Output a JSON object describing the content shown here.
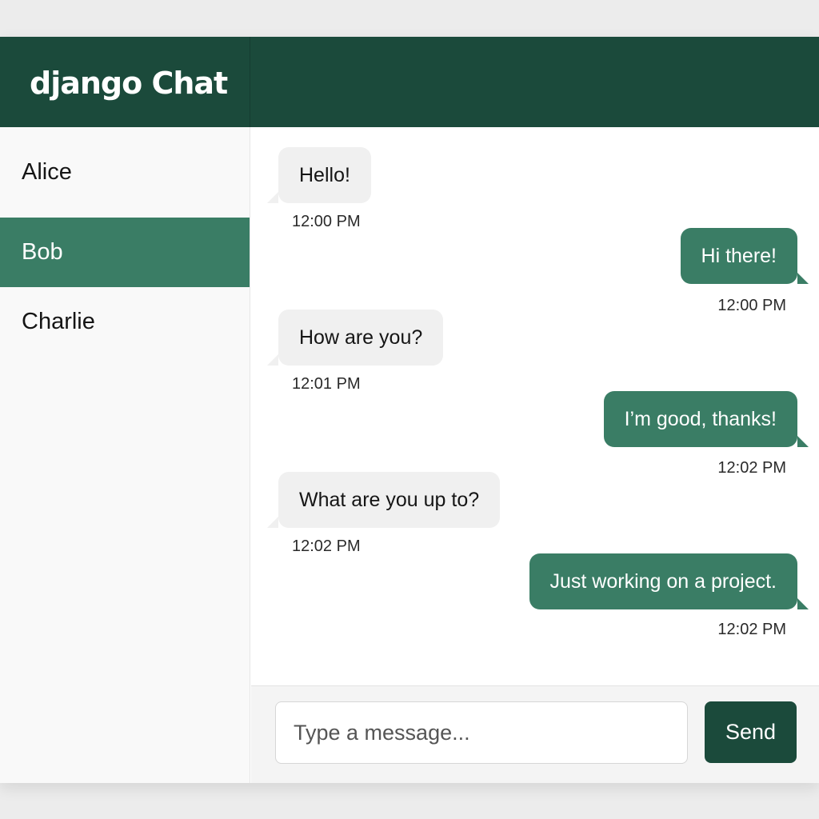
{
  "app": {
    "brand": "django Chat"
  },
  "sidebar": {
    "contacts": [
      {
        "name": "Alice"
      },
      {
        "name": "Bob",
        "active": true
      },
      {
        "name": "Charlie"
      }
    ]
  },
  "chat": {
    "messages": [
      {
        "direction": "incoming",
        "text": "Hello!",
        "time": "12:00 PM"
      },
      {
        "direction": "outgoing",
        "text": "Hi there!",
        "time": "12:00 PM"
      },
      {
        "direction": "incoming",
        "text": "How are you?",
        "time": "12:01 PM"
      },
      {
        "direction": "outgoing",
        "text": "I’m good, thanks!",
        "time": "12:02 PM"
      },
      {
        "direction": "incoming",
        "text": "What are you up to?",
        "time": "12:02 PM"
      },
      {
        "direction": "outgoing",
        "text": "Just working on a project.",
        "time": "12:02 PM"
      }
    ]
  },
  "composer": {
    "placeholder": "Type a message...",
    "value": "",
    "send_label": "Send"
  },
  "colors": {
    "header": "#1b4a3b",
    "accent": "#3a7d65",
    "incoming_bubble": "#f0f0f0"
  }
}
